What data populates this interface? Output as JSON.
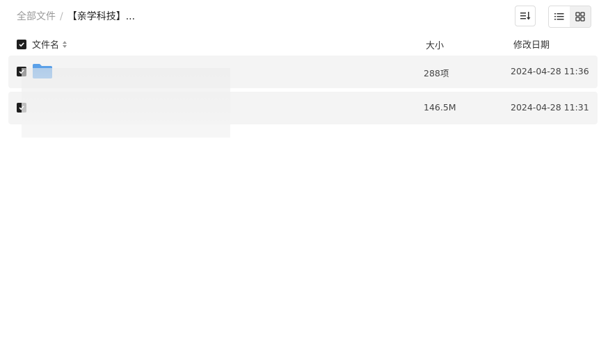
{
  "breadcrumb": {
    "root": "全部文件",
    "separator": "/",
    "current": "【亲学科技】..."
  },
  "toolbar": {
    "sort_icon": "sort-list-icon",
    "view_list_icon": "list-view-icon",
    "view_grid_icon": "grid-view-icon"
  },
  "table": {
    "headers": {
      "name": "文件名",
      "size": "大小",
      "date": "修改日期"
    },
    "rows": [
      {
        "name": "",
        "size": "288项",
        "date": "2024-04-28 11:36",
        "icon": "folder-icon"
      },
      {
        "name": "",
        "size": "146.5M",
        "date": "2024-04-28 11:31",
        "icon": "file-icon"
      }
    ]
  },
  "colors": {
    "checkbox": "#1f1f1f",
    "row_bg": "#f4f4f4",
    "folder": "#5aa0e8"
  }
}
